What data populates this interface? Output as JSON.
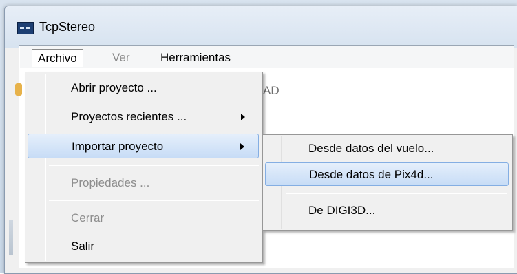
{
  "window": {
    "title": "TcpStereo"
  },
  "menubar": {
    "items": [
      {
        "label": "Archivo",
        "state": "open"
      },
      {
        "label": "Ver",
        "state": "disabled"
      },
      {
        "label": "Herramientas",
        "state": "normal"
      }
    ]
  },
  "toolbar": {
    "partial_text": "AD"
  },
  "file_menu": {
    "items": [
      {
        "label": "Abrir proyecto ...",
        "submenu": false,
        "disabled": false
      },
      {
        "label": "Proyectos recientes ...",
        "submenu": true,
        "disabled": false
      },
      {
        "label": "Importar proyecto",
        "submenu": true,
        "disabled": false,
        "highlighted": true
      },
      {
        "label": "Propiedades ...",
        "submenu": false,
        "disabled": true
      },
      {
        "label": "Cerrar",
        "submenu": false,
        "disabled": true
      },
      {
        "label": "Salir",
        "submenu": false,
        "disabled": false
      }
    ]
  },
  "import_submenu": {
    "items": [
      {
        "label": "Desde datos del vuelo..."
      },
      {
        "label": "Desde datos de Pix4d...",
        "highlighted": true
      },
      {
        "label": "De DIGI3D..."
      }
    ]
  },
  "colors": {
    "highlight_border": "#84aee3",
    "highlight_fill": "#c7dcf6",
    "menu_bg": "#f0f0f0",
    "title_bar": "#d7e3f0"
  }
}
